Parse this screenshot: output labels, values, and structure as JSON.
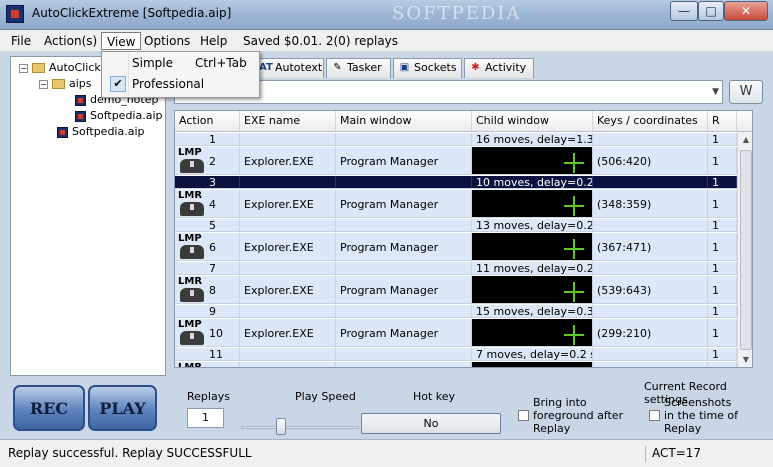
{
  "window": {
    "title": "AutoClickExtreme [Softpedia.aip]",
    "watermark": "SOFTPEDIA",
    "min_label": "—",
    "max_label": "□",
    "close_label": "✕"
  },
  "menubar": {
    "file": "File",
    "action": "Action(s)",
    "view": "View",
    "options": "Options",
    "help": "Help",
    "status": "Saved $0.01. 2(0) replays"
  },
  "view_menu": {
    "simple": "Simple",
    "simple_shortcut": "Ctrl+Tab",
    "professional": "Professional",
    "check": "✔"
  },
  "tree": {
    "root": "AutoClick",
    "folder": "aips",
    "file1": "demo_notep",
    "file2": "Softpedia.aip",
    "file3": "Softpedia.aip",
    "expander": "−"
  },
  "tabs": [
    {
      "label": "Autotext",
      "icon": "AT"
    },
    {
      "label": "Tasker",
      "icon": "✎"
    },
    {
      "label": "Sockets",
      "icon": "▣"
    },
    {
      "label": "Activity",
      "icon": "✱"
    }
  ],
  "search": {
    "value": "",
    "arrow": "▼",
    "button": "W"
  },
  "grid": {
    "headers": [
      "Action type",
      "EXE name",
      "Main window",
      "Child window",
      "Keys / coordinates",
      "R"
    ],
    "rows": [
      {
        "icon": "",
        "num": "1",
        "exe": "",
        "main": "",
        "child": "16 moves, delay=1.3 ...",
        "keys": "",
        "r": "1"
      },
      {
        "icon": "LMP",
        "num": "2",
        "exe": "Explorer.EXE",
        "main": "Program Manager",
        "child": "",
        "keys": "(506:420)",
        "r": "1"
      },
      {
        "icon": "",
        "num": "3",
        "exe": "",
        "main": "",
        "child": "10 moves, delay=0.2 ...",
        "keys": "",
        "r": "1"
      },
      {
        "icon": "LMR",
        "num": "4",
        "exe": "Explorer.EXE",
        "main": "Program Manager",
        "child": "",
        "keys": "(348:359)",
        "r": "1"
      },
      {
        "icon": "",
        "num": "5",
        "exe": "",
        "main": "",
        "child": "13 moves, delay=0.2 ...",
        "keys": "",
        "r": "1"
      },
      {
        "icon": "LMP",
        "num": "6",
        "exe": "Explorer.EXE",
        "main": "Program Manager",
        "child": "",
        "keys": "(367:471)",
        "r": "1"
      },
      {
        "icon": "",
        "num": "7",
        "exe": "",
        "main": "",
        "child": "11 moves, delay=0.2 ...",
        "keys": "",
        "r": "1"
      },
      {
        "icon": "LMR",
        "num": "8",
        "exe": "Explorer.EXE",
        "main": "Program Manager",
        "child": "",
        "keys": "(539:643)",
        "r": "1"
      },
      {
        "icon": "",
        "num": "9",
        "exe": "",
        "main": "",
        "child": "15 moves, delay=0.3 ...",
        "keys": "",
        "r": "1"
      },
      {
        "icon": "LMP",
        "num": "10",
        "exe": "Explorer.EXE",
        "main": "Program Manager",
        "child": "",
        "keys": "(299:210)",
        "r": "1"
      },
      {
        "icon": "",
        "num": "11",
        "exe": "",
        "main": "",
        "child": "7 moves, delay=0.2 sec",
        "keys": "",
        "r": "1"
      },
      {
        "icon": "LMR",
        "num": "",
        "exe": "",
        "main": "",
        "child": "",
        "keys": "",
        "r": "1"
      }
    ],
    "selected_row": 2
  },
  "controls": {
    "rec": "REC",
    "play": "PLAY",
    "replays_label": "Replays",
    "replays_value": "1",
    "speed_label": "Play Speed",
    "hotkey_label": "Hot key",
    "hotkey_value": "No",
    "foreground_label_1": "Bring into",
    "foreground_label_2": "foreground after",
    "foreground_label_3": "Replay",
    "current_settings": "Current Record settings",
    "screenshots_1": "Screenshots",
    "screenshots_2": "in the time of",
    "screenshots_3": "Replay",
    "speed_fraction": 0.34
  },
  "statusbar": {
    "message": "Replay successful. Replay SUCCESSFULL",
    "act": "ACT=17"
  },
  "colors": {
    "accent": "#0c1240",
    "row_light": "#dce8f8",
    "crosshair": "#5ec828"
  }
}
